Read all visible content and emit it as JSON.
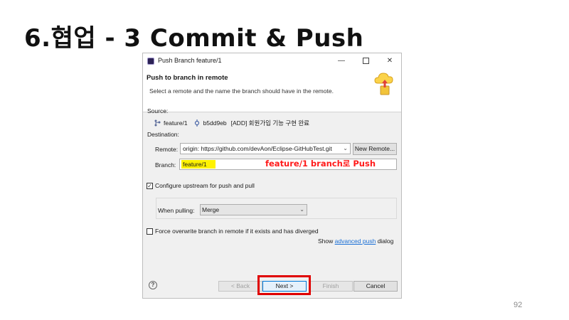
{
  "slide": {
    "title": "6.협업 - 3 Commit & Push",
    "page_number": "92"
  },
  "dialog": {
    "window_title": "Push Branch feature/1",
    "heading": "Push to branch in remote",
    "description": "Select a remote and the name the branch should have in the remote.",
    "source_label": "Source:",
    "source_branch": "feature/1",
    "source_commit_id": "b5dd9eb",
    "source_commit_message": "[ADD] 회원가입 기능 구현 완료",
    "destination_label": "Destination:",
    "remote_label": "Remote:",
    "remote_value": "origin: https://github.com/devAon/Eclipse-GitHubTest.git",
    "new_remote_button": "New Remote...",
    "branch_label": "Branch:",
    "branch_value": "feature/1",
    "annotation": "feature/1 branch로 Push",
    "configure_upstream_label": "Configure upstream for push and pull",
    "configure_upstream_checked": true,
    "when_pulling_label": "When pulling:",
    "when_pulling_value": "Merge",
    "force_overwrite_label": "Force overwrite branch in remote if it exists and has diverged",
    "force_overwrite_checked": false,
    "show_text": "Show",
    "advanced_push_link": "advanced push",
    "dialog_text": "dialog",
    "buttons": {
      "back": "< Back",
      "next": "Next >",
      "finish": "Finish",
      "cancel": "Cancel"
    },
    "colors": {
      "highlight": "#e00000",
      "annotation": "#ff1a1a",
      "branch_highlight": "#fff200",
      "link": "#1a6fd6"
    }
  }
}
